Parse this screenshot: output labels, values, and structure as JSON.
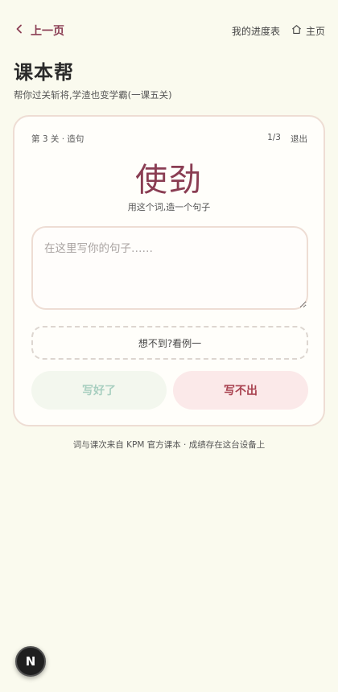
{
  "nav": {
    "back_label": "上一页",
    "progress_label": "我的进度表",
    "home_label": "主页"
  },
  "app": {
    "title": "课本帮",
    "subtitle": "帮你过关斩将,学渣也变学霸(一课五关)"
  },
  "card": {
    "level_label": "第 3 关 · 造句",
    "counter": "1/3",
    "exit_label": "退出",
    "word": "使劲",
    "instruction": "用这个词,造一个句子",
    "input": {
      "value": "",
      "placeholder": "在这里写你的句子……"
    },
    "hint_label": "想不到?看例一",
    "done_label": "写好了",
    "stuck_label": "写不出"
  },
  "footer": "词与课次来自 KPM 官方课本 · 成绩存在这台设备上",
  "fab_label": "N",
  "colors": {
    "accent": "#8a3d53",
    "background": "#fafaee",
    "card_border": "#eeddd4",
    "done_bg": "#f3f7ee",
    "done_text": "#a8cfc0",
    "stuck_bg": "#fbe9e9",
    "stuck_text": "#a8404e"
  },
  "icons": {
    "back": "chevron-left-icon",
    "home": "home-icon"
  }
}
